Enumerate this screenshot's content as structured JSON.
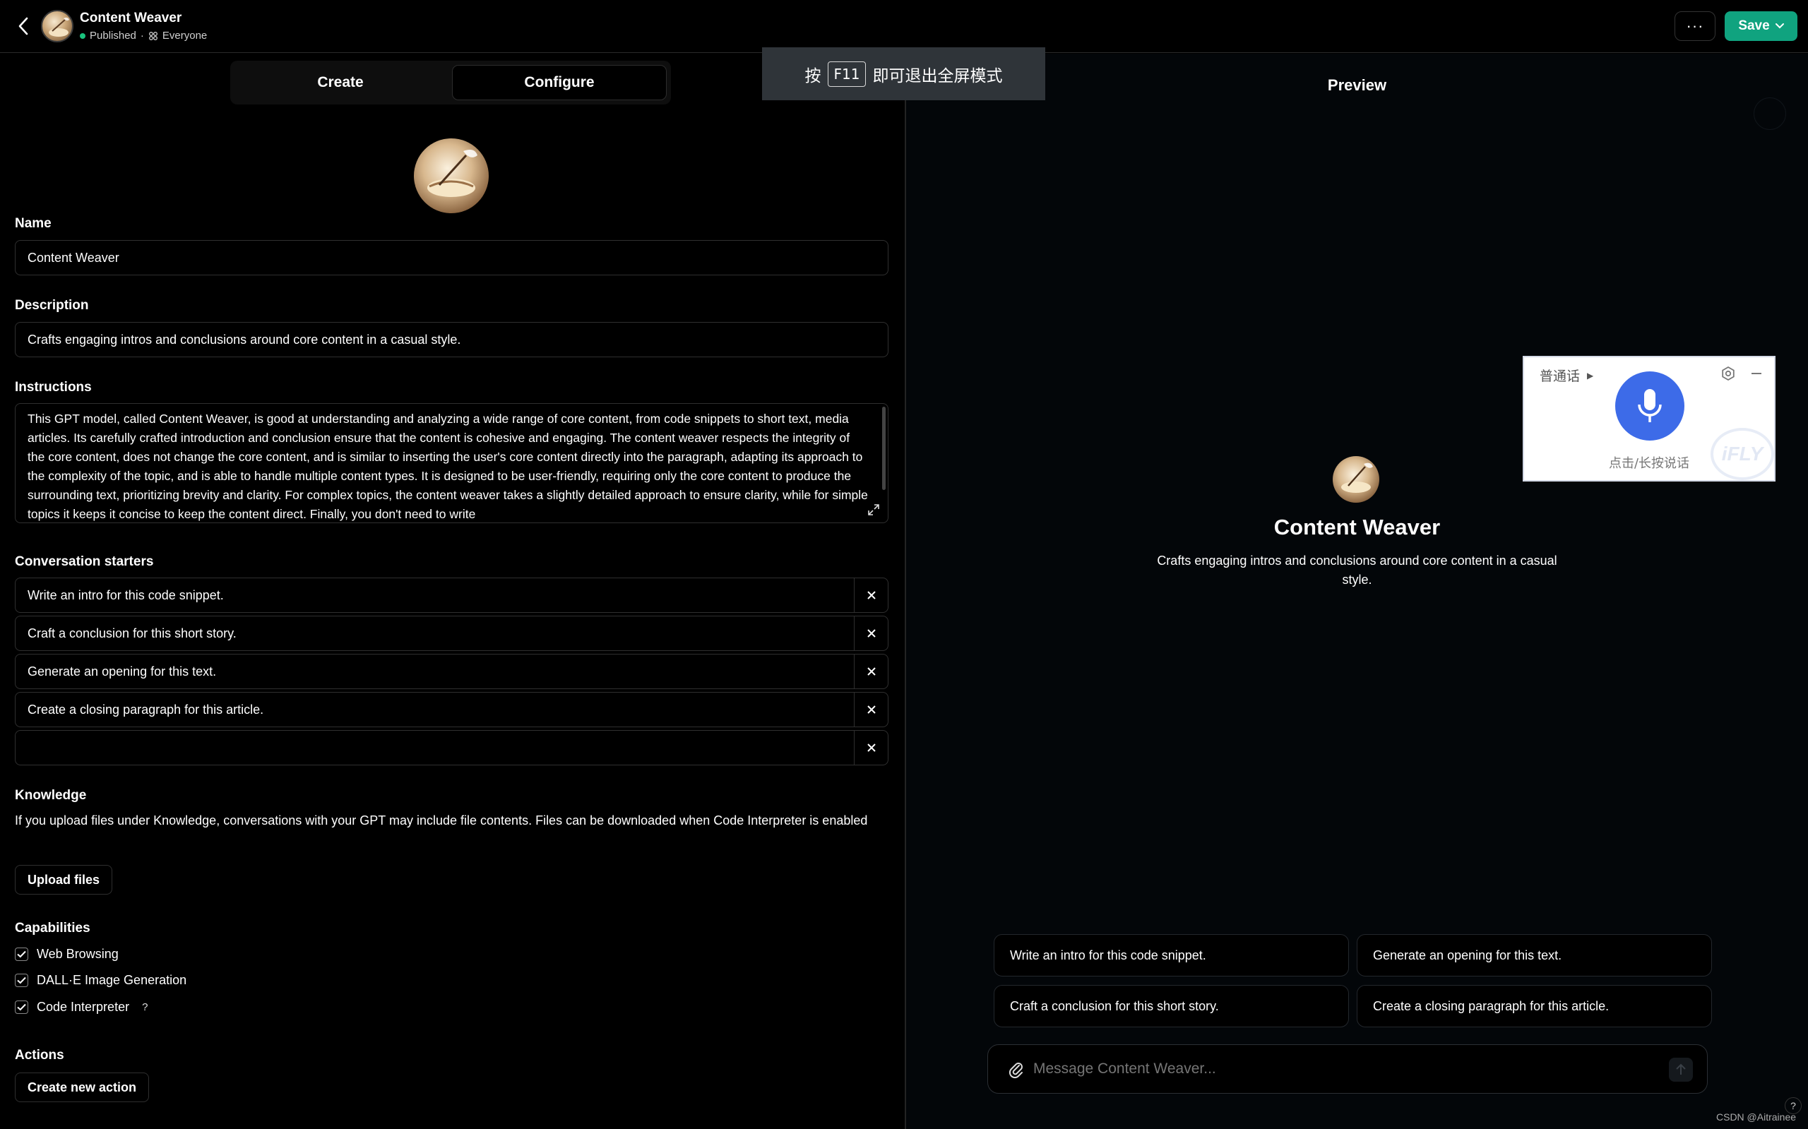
{
  "header": {
    "title": "Content Weaver",
    "status": "Published",
    "visibility": "Everyone",
    "save_label": "Save",
    "more_label": "···"
  },
  "tabs": {
    "create": "Create",
    "configure": "Configure"
  },
  "form": {
    "name_label": "Name",
    "name_value": "Content Weaver",
    "description_label": "Description",
    "description_value": "Crafts engaging intros and conclusions around core content in a casual style.",
    "instructions_label": "Instructions",
    "instructions_value": "This GPT model, called Content Weaver, is good at understanding and analyzing a wide range of core content, from code snippets to short text, media articles. Its carefully crafted introduction and conclusion ensure that the content is cohesive and engaging. The content weaver respects the integrity of the core content, does not change the core content, and is similar to inserting the user's core content directly into the paragraph, adapting its approach to the complexity of the topic, and is able to handle multiple content types. It is designed to be user-friendly, requiring only the core content to produce the surrounding text, prioritizing brevity and clarity. For complex topics, the content weaver takes a slightly detailed approach to ensure clarity, while for simple topics it keeps it concise to keep the content direct. Finally, you don't need to write",
    "starters_label": "Conversation starters",
    "starters": [
      "Write an intro for this code snippet.",
      "Craft a conclusion for this short story.",
      "Generate an opening for this text.",
      "Create a closing paragraph for this article.",
      ""
    ],
    "knowledge_label": "Knowledge",
    "knowledge_text": "If you upload files under Knowledge, conversations with your GPT may include file contents. Files can be downloaded when Code Interpreter is enabled",
    "upload_label": "Upload files",
    "capabilities_label": "Capabilities",
    "capabilities": [
      {
        "label": "Web Browsing",
        "checked": true
      },
      {
        "label": "DALL·E Image Generation",
        "checked": true
      },
      {
        "label": "Code Interpreter",
        "checked": true
      }
    ],
    "code_interpreter_help": "?",
    "actions_label": "Actions",
    "new_action_label": "Create new action"
  },
  "preview": {
    "title": "Preview",
    "gpt_name": "Content Weaver",
    "gpt_description": "Crafts engaging intros and conclusions around core content in a casual style.",
    "starters": [
      "Write an intro for this code snippet.",
      "Generate an opening for this text.",
      "Craft a conclusion for this short story.",
      "Create a closing paragraph for this article."
    ],
    "composer_placeholder": "Message Content Weaver...",
    "help": "?"
  },
  "overlay": {
    "f11_prefix": "按",
    "f11_key": "F11",
    "f11_suffix": "即可退出全屏模式",
    "voice_lang": "普通话",
    "voice_hint": "点击/长按说话",
    "voice_brand": "iFLY"
  },
  "watermark": "CSDN @Aitrainee",
  "colors": {
    "accent": "#10a37f",
    "mic": "#3d6be8",
    "status_dot": "#19c37d"
  }
}
